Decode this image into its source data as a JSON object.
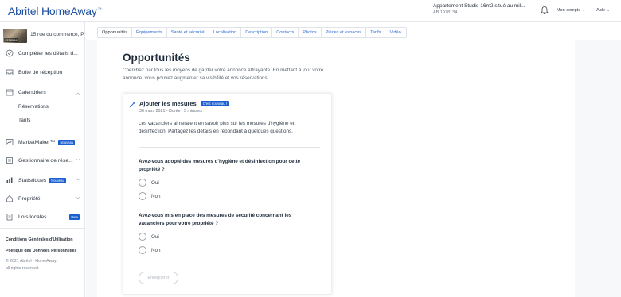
{
  "app": {
    "logo": "Abritel HomeAway",
    "logo_mark": "™"
  },
  "topbar": {
    "property_name": "Appartement Studio 16m2 situé au mil...",
    "property_id": "AB 1978134",
    "account_label": "Mon compte",
    "help_label": "Aide",
    "bell_icon": "bell-icon"
  },
  "sidebar": {
    "address": "15 rue du commerce, P",
    "thumb_tag": "1978134",
    "items": [
      {
        "label": "Compléter les détails d...",
        "icon": "checklist-icon"
      },
      {
        "label": "Boîte de réception",
        "icon": "inbox-icon"
      },
      {
        "label": "Calendriers",
        "icon": "calendar-icon"
      },
      {
        "label": "MarketMaker™",
        "icon": "chart-icon",
        "badge": "Nouveau"
      },
      {
        "label": "Gestionnaire de rése...",
        "icon": "booking-icon"
      },
      {
        "label": "Statistiques",
        "icon": "bar-chart-icon",
        "badge": "Nouveau"
      },
      {
        "label": "Propriété",
        "icon": "house-icon"
      },
      {
        "label": "Lois locales",
        "icon": "law-icon",
        "badge": "Beta"
      }
    ],
    "subitems": [
      "Réservations",
      "Tarifs"
    ],
    "footer": {
      "terms": "Conditions Générales d'Utilisation",
      "privacy": "Politique des Données Personnelles",
      "copyright": "© 2021 Abritel - HomeAway,",
      "rights": "all rights reserved."
    }
  },
  "tabs": [
    "Opportunités",
    "Équipements",
    "Santé et sécurité",
    "Localisation",
    "Description",
    "Contacts",
    "Photos",
    "Pièces et espaces",
    "Tarifs",
    "Vidéo"
  ],
  "main": {
    "title": "Opportunités",
    "intro": "Cherchez par tous les moyens de garder votre annonce attrayante. En mettant à jour votre annonce, vous pouvez augmenter sa visibilité et vos réservations."
  },
  "card": {
    "title": "Ajouter les mesures",
    "new_badge": "C'est nouveau !",
    "meta": "30 mars 2021 - Durée : 5 minutes",
    "description": "Les vacanciers aimeraient en savoir plus sur les mesures d'hygiène et désinfection. Partagez les détails en répondant à quelques questions.",
    "q1": "Avez-vous adopté des mesures d'hygiène et désinfection pour cette propriété ?",
    "q2": "Avez-vous mis en place des mesures de sécurité concernant les vacanciers pour votre propriété ?",
    "yes": "Oui",
    "no": "Non",
    "save": "Enregistrer"
  },
  "colors": {
    "brand": "#1c4fa0",
    "badge": "#1c5fd0",
    "link": "#2f6bd6"
  }
}
